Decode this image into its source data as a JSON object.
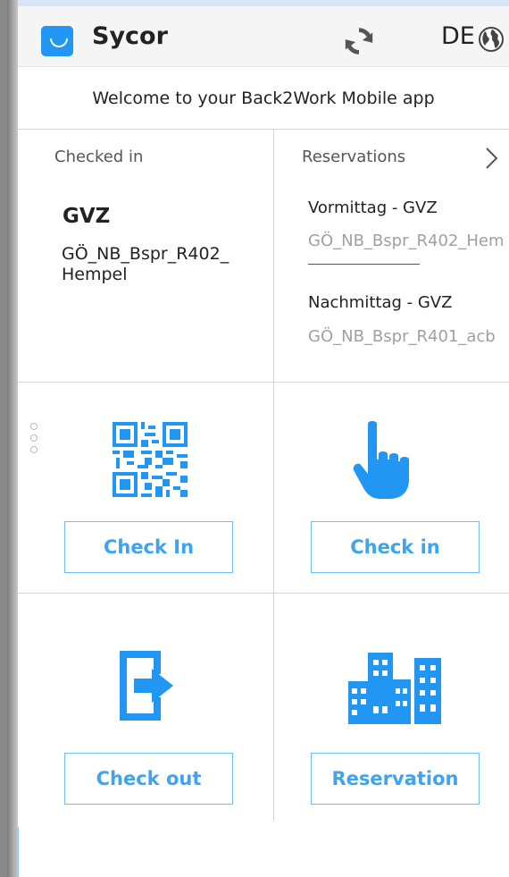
{
  "header": {
    "app_title": "Sycor",
    "language": "DE",
    "icons": {
      "logo": "sycor-logo-icon",
      "sync": "sync-icon",
      "globe": "globe-icon"
    },
    "accent_color": "#2196f3"
  },
  "welcome": {
    "text": "Welcome to your Back2Work Mobile app"
  },
  "checked_in": {
    "label": "Checked in",
    "site": "GVZ",
    "room": "GÖ_NB_Bspr_R402_Hempel"
  },
  "reservations": {
    "label": "Reservations",
    "items": [
      {
        "title": "Vormittag - GVZ",
        "room": "GÖ_NB_Bspr_R402_Hem"
      },
      {
        "title": "Nachmittag - GVZ",
        "room": "GÖ_NB_Bspr_R401_acb"
      }
    ]
  },
  "actions": {
    "check_in_qr": "Check In",
    "check_in_manual": "Check in",
    "check_out": "Check out",
    "reservation": "Reservation"
  }
}
